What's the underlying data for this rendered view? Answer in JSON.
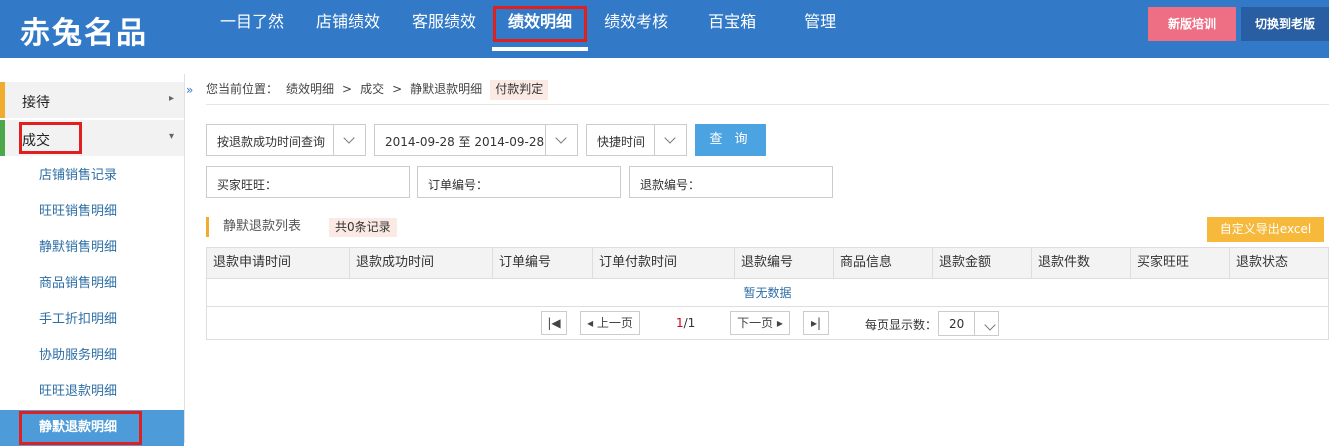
{
  "header": {
    "logo": "赤兔名品",
    "nav": [
      "一目了然",
      "店铺绩效",
      "客服绩效",
      "绩效明细",
      "绩效考核",
      "百宝箱",
      "管理"
    ],
    "active_nav": "绩效明细",
    "btn_new": "新版培训",
    "btn_old": "切换到老版"
  },
  "sidebar": {
    "group1": "接待",
    "group2": "成交",
    "items": [
      "店铺销售记录",
      "旺旺销售明细",
      "静默销售明细",
      "商品销售明细",
      "手工折扣明细",
      "协助服务明细",
      "旺旺退款明细",
      "静默退款明细"
    ],
    "collapse_icon": "»"
  },
  "breadcrumb": {
    "prefix": "您当前位置：",
    "l1": "绩效明细",
    "sep": ">",
    "l2": "成交",
    "l3": "静默退款明细",
    "tag": "付款判定"
  },
  "filters": {
    "mode": "按退款成功时间查询",
    "date_range": "2014-09-28 至 2014-09-28",
    "quick": "快捷时间",
    "query_btn": "查 询",
    "buyer_label": "买家旺旺：",
    "order_label": "订单编号：",
    "refund_label": "退款编号："
  },
  "list": {
    "title": "静默退款列表",
    "count": "共0条记录",
    "export_btn": "自定义导出excel",
    "columns": [
      "退款申请时间",
      "退款成功时间",
      "订单编号",
      "订单付款时间",
      "退款编号",
      "商品信息",
      "退款金额",
      "退款件数",
      "买家旺旺",
      "退款状态"
    ],
    "empty": "暂无数据"
  },
  "pager": {
    "first": "|◀",
    "prev": "◂ 上一页",
    "current": "1",
    "total": "/1",
    "next": "下一页 ▸",
    "last": "▸|",
    "per_page_label": "每页显示数：",
    "per_page": "20"
  }
}
